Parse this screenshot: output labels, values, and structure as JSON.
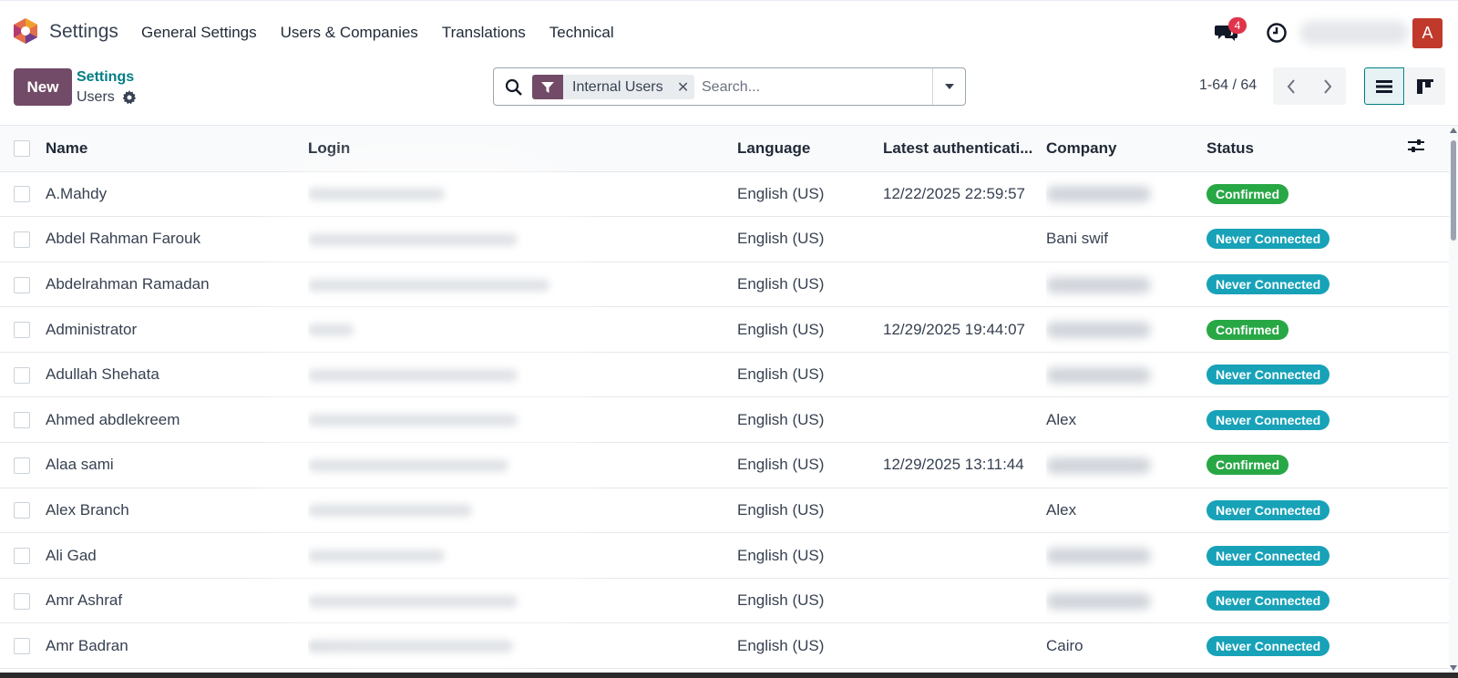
{
  "navbar": {
    "app_name": "Settings",
    "menu": [
      "General Settings",
      "Users & Companies",
      "Translations",
      "Technical"
    ],
    "chat_count": "4",
    "avatar_initial": "A"
  },
  "control": {
    "new_label": "New",
    "breadcrumb_parent": "Settings",
    "breadcrumb_current": "Users",
    "facet_label": "Internal Users",
    "search_placeholder": "Search...",
    "pager": "1-64 / 64"
  },
  "table": {
    "headers": [
      "Name",
      "Login",
      "Language",
      "Latest authenticati...",
      "Company",
      "Status"
    ],
    "rows": [
      {
        "name": "A.Mahdy",
        "language": "English (US)",
        "latest": "12/22/2025 22:59:57",
        "company": "",
        "status": "Confirmed"
      },
      {
        "name": "Abdel Rahman Farouk",
        "language": "English (US)",
        "latest": "",
        "company": "Bani swif",
        "status": "Never Connected"
      },
      {
        "name": "Abdelrahman Ramadan",
        "language": "English (US)",
        "latest": "",
        "company": "",
        "status": "Never Connected"
      },
      {
        "name": "Administrator",
        "language": "English (US)",
        "latest": "12/29/2025 19:44:07",
        "company": "",
        "status": "Confirmed"
      },
      {
        "name": "Adullah Shehata",
        "language": "English (US)",
        "latest": "",
        "company": "",
        "status": "Never Connected"
      },
      {
        "name": "Ahmed abdlekreem",
        "language": "English (US)",
        "latest": "",
        "company": "Alex",
        "status": "Never Connected"
      },
      {
        "name": "Alaa sami",
        "language": "English (US)",
        "latest": "12/29/2025 13:11:44",
        "company": "",
        "status": "Confirmed"
      },
      {
        "name": "Alex Branch",
        "language": "English (US)",
        "latest": "",
        "company": "Alex",
        "status": "Never Connected"
      },
      {
        "name": "Ali Gad",
        "language": "English (US)",
        "latest": "",
        "company": "",
        "status": "Never Connected"
      },
      {
        "name": "Amr Ashraf",
        "language": "English (US)",
        "latest": "",
        "company": "",
        "status": "Never Connected"
      },
      {
        "name": "Amr Badran",
        "language": "English (US)",
        "latest": "",
        "company": "Cairo",
        "status": "Never Connected"
      }
    ]
  },
  "colors": {
    "brand": "#714b67",
    "link": "#017e84",
    "confirmed": "#28a745",
    "never_connected": "#17a2b8"
  }
}
